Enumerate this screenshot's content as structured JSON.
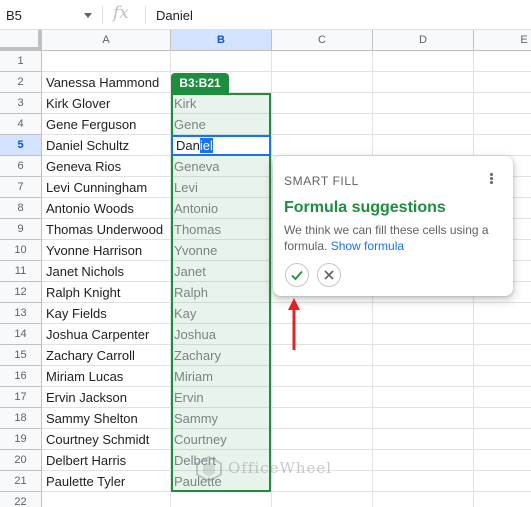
{
  "formula_bar": {
    "name_box": "B5",
    "fx_label": "fx",
    "content": "Daniel"
  },
  "columns": [
    {
      "label": "A",
      "selected": false
    },
    {
      "label": "B",
      "selected": true
    },
    {
      "label": "C",
      "selected": false
    },
    {
      "label": "D",
      "selected": false
    },
    {
      "label": "E",
      "selected": false
    }
  ],
  "rows": [
    {
      "num": "1",
      "a": "",
      "b": ""
    },
    {
      "num": "2",
      "a": "Vanessa Hammond",
      "b": ""
    },
    {
      "num": "3",
      "a": "Kirk Glover",
      "b": "Kirk"
    },
    {
      "num": "4",
      "a": "Gene Ferguson",
      "b": "Gene"
    },
    {
      "num": "5",
      "a": "Daniel Schultz",
      "b": ""
    },
    {
      "num": "6",
      "a": "Geneva Rios",
      "b": "Geneva"
    },
    {
      "num": "7",
      "a": "Levi Cunningham",
      "b": "Levi"
    },
    {
      "num": "8",
      "a": "Antonio Woods",
      "b": "Antonio"
    },
    {
      "num": "9",
      "a": "Thomas Underwood",
      "b": "Thomas"
    },
    {
      "num": "10",
      "a": "Yvonne Harrison",
      "b": "Yvonne"
    },
    {
      "num": "11",
      "a": "Janet Nichols",
      "b": "Janet"
    },
    {
      "num": "12",
      "a": "Ralph Knight",
      "b": "Ralph"
    },
    {
      "num": "13",
      "a": "Kay Fields",
      "b": "Kay"
    },
    {
      "num": "14",
      "a": "Joshua Carpenter",
      "b": "Joshua"
    },
    {
      "num": "15",
      "a": "Zachary Carroll",
      "b": "Zachary"
    },
    {
      "num": "16",
      "a": "Miriam Lucas",
      "b": "Miriam"
    },
    {
      "num": "17",
      "a": "Ervin Jackson",
      "b": "Ervin"
    },
    {
      "num": "18",
      "a": "Sammy Shelton",
      "b": "Sammy"
    },
    {
      "num": "19",
      "a": "Courtney Schmidt",
      "b": "Courtney"
    },
    {
      "num": "20",
      "a": "Delbert Harris",
      "b": "Delbert"
    },
    {
      "num": "21",
      "a": "Paulette Tyler",
      "b": "Paulette"
    },
    {
      "num": "22",
      "a": "",
      "b": ""
    }
  ],
  "selected_row": "5",
  "range_label": "B3:B21",
  "active_cell": {
    "text_before": "Dan",
    "text_highlight": "iel"
  },
  "smart_fill": {
    "header": "SMART FILL",
    "title": "Formula suggestions",
    "description": "We think we can fill these cells using a formula.",
    "link": "Show formula",
    "accept_icon": "check-icon",
    "reject_icon": "close-icon",
    "menu_icon": "more-vert-icon"
  },
  "watermark": {
    "text": "OfficeWheel"
  },
  "colors": {
    "range_green": "#1e8e3e",
    "active_blue": "#1a73e8",
    "arrow_red": "#e02424",
    "link_blue": "#1a73e8"
  }
}
